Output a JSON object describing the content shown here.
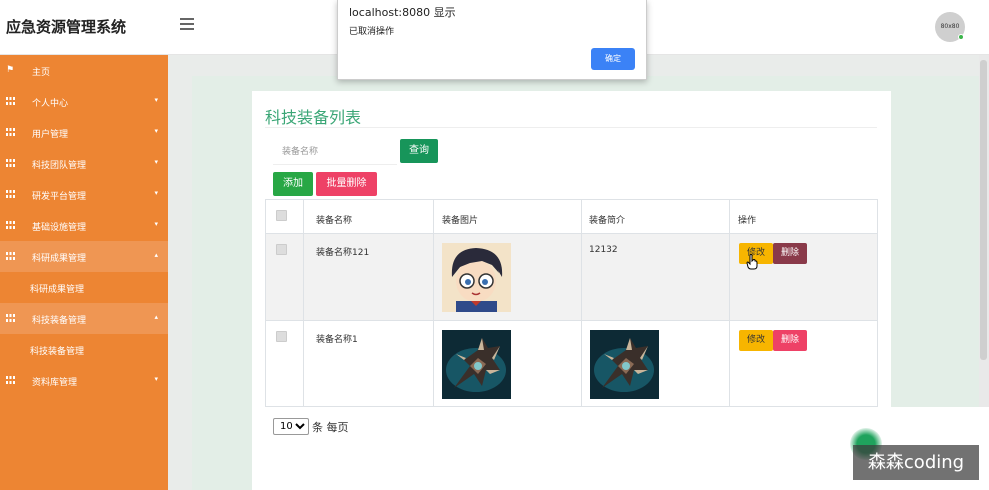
{
  "header": {
    "brand": "应急资源管理系统",
    "avatar_text": "80x80"
  },
  "sidebar": {
    "items": [
      {
        "label": "主页"
      },
      {
        "label": "个人中心"
      },
      {
        "label": "用户管理"
      },
      {
        "label": "科技团队管理"
      },
      {
        "label": "研发平台管理"
      },
      {
        "label": "基础设施管理"
      },
      {
        "label": "科研成果管理"
      },
      {
        "label": "科研成果管理"
      },
      {
        "label": "科技装备管理"
      },
      {
        "label": "科技装备管理"
      },
      {
        "label": "资料库管理"
      }
    ]
  },
  "page": {
    "title": "科技装备列表",
    "search_placeholder": "装备名称",
    "query_label": "查询",
    "add_label": "添加",
    "batch_delete_label": "批量删除"
  },
  "table": {
    "headers": [
      "装备名称",
      "装备图片",
      "装备简介",
      "操作"
    ],
    "rows": [
      {
        "name": "装备名称121",
        "intro": "12132",
        "edit": "修改",
        "delete": "删除"
      },
      {
        "name": "装备名称1",
        "intro": "",
        "edit": "修改",
        "delete": "删除"
      }
    ]
  },
  "pager": {
    "page_size": "10",
    "per_page_text": "条 每页",
    "options": [
      "10"
    ]
  },
  "dialog": {
    "title": "localhost:8080 显示",
    "message": "已取消操作",
    "ok_label": "确定"
  },
  "watermark": "森森coding",
  "colors": {
    "sidebar": "#ed8533",
    "title": "#3aa676",
    "query": "#17955a",
    "add": "#28a745",
    "delete": "#ee4166",
    "edit": "#f7b500",
    "dialog_ok": "#3b82f6"
  }
}
